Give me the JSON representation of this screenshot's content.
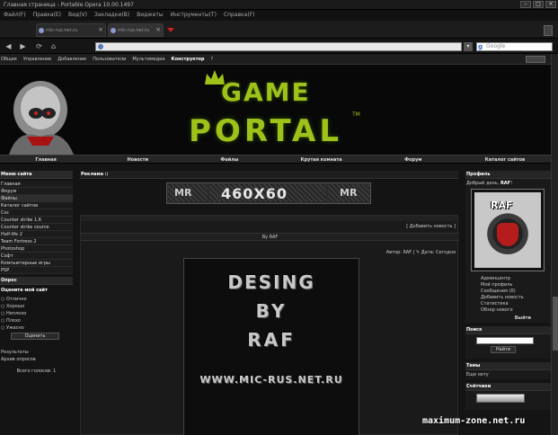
{
  "browser": {
    "title": "Главная страница - Portable Opera 10.00.1497",
    "menus": [
      "Файл(F)",
      "Правка(E)",
      "Вид(V)",
      "Закладки(B)",
      "Виджеты",
      "Инструменты(T)",
      "Справка(F)"
    ],
    "tabs": [
      {
        "label": "mic-rus.net.ru"
      },
      {
        "label": "mic-rus.net.ru"
      }
    ],
    "search_placeholder": "Google",
    "search_engine_letter": "g",
    "icons": {
      "back": "◀",
      "forward": "▶",
      "reload": "⟳",
      "home": "⌂",
      "close": "×",
      "dropdown": "▾"
    }
  },
  "site": {
    "adminbar": {
      "items": [
        "Общее",
        "Управление",
        "Добавление",
        "Пользователи",
        "Мультимедиа"
      ],
      "bold_item": "Конструктор",
      "help": "?"
    },
    "logo": {
      "line1": "GAME",
      "line2": "PORTAL",
      "tm": "TM"
    },
    "nav": [
      "Главная",
      "Новости",
      "Файлы",
      "Крутая комната",
      "Форум",
      "Каталог сайтов"
    ],
    "left": {
      "menu_title": "Меню сайта",
      "menu_items": [
        "Главная",
        "Форум",
        "Файлы",
        "Каталог сайтов",
        "Css",
        "Counter strike 1.6",
        "Counter strike source",
        "Half-life 2",
        "Team Fortress 2",
        "Photoshop",
        "Софт",
        "Компьютерные игры",
        "PSP"
      ],
      "poll_title": "Опрос",
      "poll_question": "Оцените мой сайт",
      "poll_options": [
        "Отлично",
        "Хорошо",
        "Неплохо",
        "Плохо",
        "Ужасно"
      ],
      "vote_button": "Оценить",
      "results": "Результаты",
      "archive": "Архив опросов",
      "total": "Всего голосов: 1"
    },
    "main": {
      "ad_title": "Реклама ::",
      "banner_text": "460X60",
      "banner_logo": "MR",
      "add_news": "[ Добавить новость ]",
      "byline": "By RAF",
      "meta": "Автор: RAF | ✎ Дата: Сегодня",
      "image_text": {
        "line1": "DESING",
        "line2": "BY",
        "line3": "RAF",
        "line4": "WWW.MIC-RUS.NET.RU"
      }
    },
    "right": {
      "profile_title": "Профиль",
      "greeting_prefix": "Добрый день,",
      "greeting_name": "RAF",
      "greeting_suffix": "!",
      "avatar_text": "RAF",
      "profile_links": [
        "Админцентр",
        "Мой профиль",
        "Сообщения (0)",
        "Добавить новость",
        "Статистика",
        "Обзор нового"
      ],
      "logout": "Выйти",
      "search_title": "Поиск",
      "search_button": "Найти",
      "topics_title": "Темы",
      "topics_item": "Еще нету",
      "counters_title": "Счётчики"
    }
  },
  "watermark": "maximum-zone.net.ru"
}
